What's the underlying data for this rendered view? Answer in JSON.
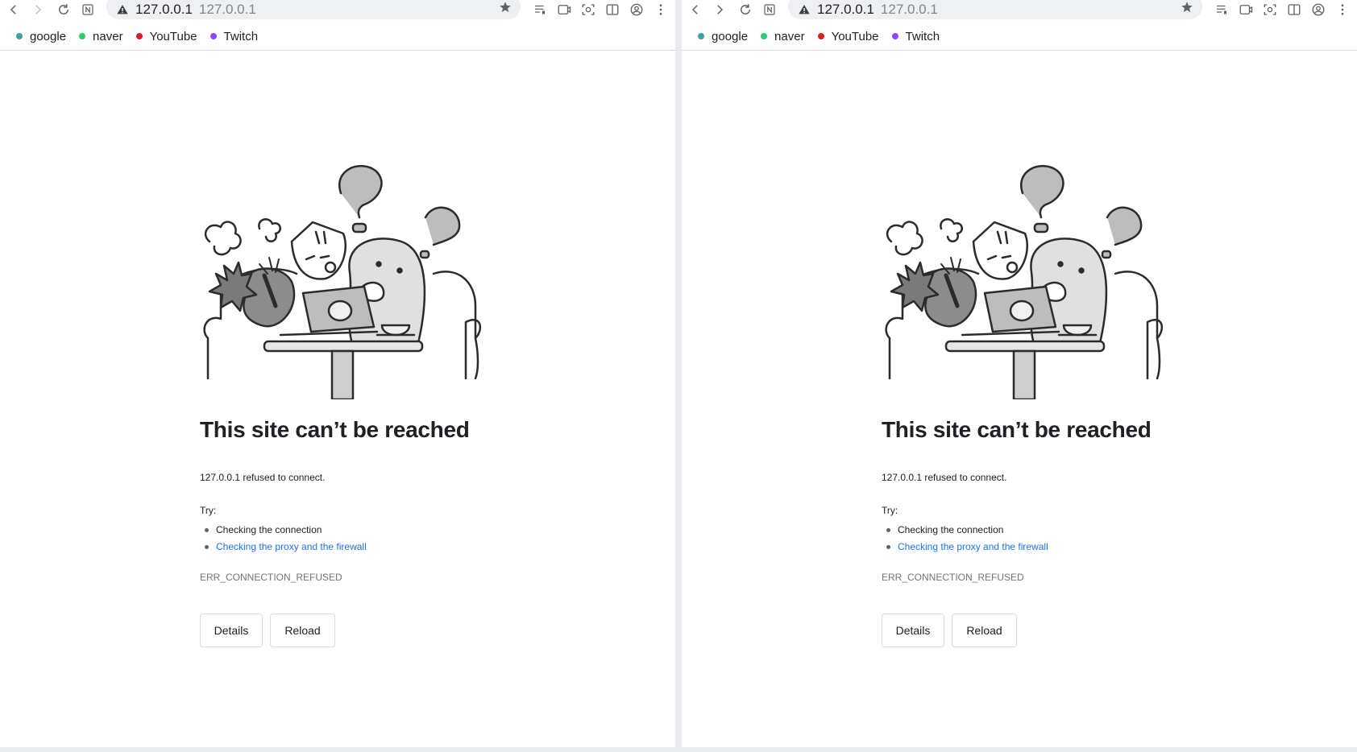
{
  "toolbar": {
    "host": "127.0.0.1",
    "path": "127.0.0.1",
    "icons": [
      "back-icon",
      "forward-icon",
      "reload-icon",
      "notion-icon",
      "not-secure-icon",
      "bookmark-star-icon",
      "reading-list-icon",
      "video-icon",
      "screenshot-icon",
      "side-panel-icon",
      "profile-icon",
      "menu-icon"
    ]
  },
  "bookmarks": [
    {
      "label": "google",
      "color": "#3aa39a"
    },
    {
      "label": "naver",
      "color": "#2ecc71"
    },
    {
      "label": "YouTube",
      "color": "#e01b24"
    },
    {
      "label": "Twitch",
      "color": "#9146ff"
    }
  ],
  "error": {
    "title": "This site can’t be reached",
    "message": "127.0.0.1 refused to connect.",
    "try_label": "Try:",
    "suggestions": [
      {
        "text": "Checking the connection",
        "is_link": false
      },
      {
        "text": "Checking the proxy and the firewall",
        "is_link": true
      }
    ],
    "code": "ERR_CONNECTION_REFUSED",
    "details_label": "Details",
    "reload_label": "Reload"
  },
  "colors": {
    "link": "#1a73e8",
    "text": "#202124",
    "muted": "#70757a",
    "omnibox": "#eef0f3"
  }
}
